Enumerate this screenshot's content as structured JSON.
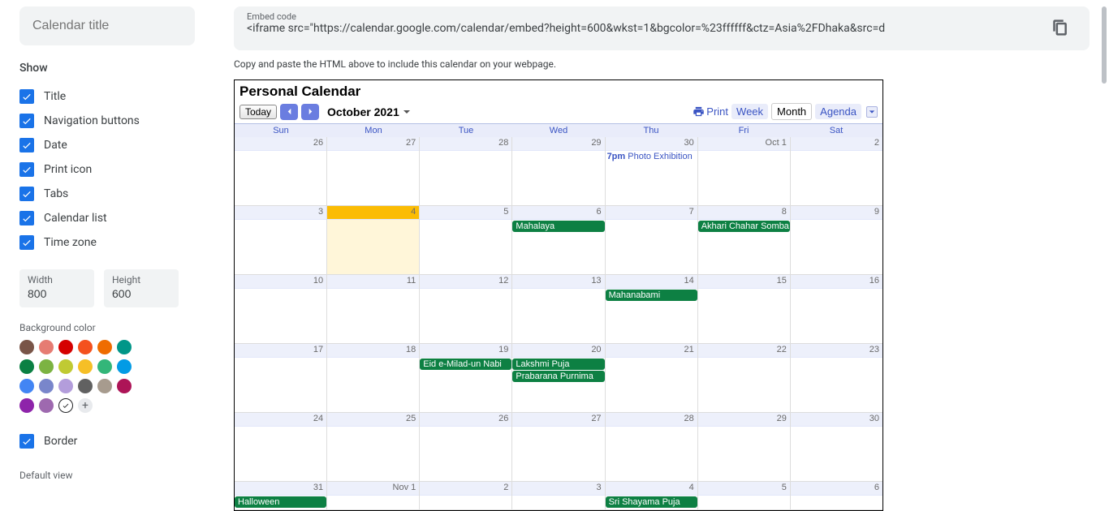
{
  "sidebar": {
    "title_placeholder": "Calendar title",
    "show_heading": "Show",
    "checks": [
      {
        "label": "Title"
      },
      {
        "label": "Navigation buttons"
      },
      {
        "label": "Date"
      },
      {
        "label": "Print icon"
      },
      {
        "label": "Tabs"
      },
      {
        "label": "Calendar list"
      },
      {
        "label": "Time zone"
      }
    ],
    "width_label": "Width",
    "width_value": "800",
    "height_label": "Height",
    "height_value": "600",
    "bg_heading": "Background color",
    "colors": [
      "#795548",
      "#e67c73",
      "#d50000",
      "#f4511e",
      "#ef6c00",
      "#009688",
      "#0b8043",
      "#7cb342",
      "#c0ca33",
      "#f6bf26",
      "#33b679",
      "#039be5",
      "#4285f4",
      "#7986cb",
      "#b39ddb",
      "#616161",
      "#a79b8e",
      "#ad1457",
      "#8e24aa",
      "#9e69af"
    ],
    "border_label": "Border",
    "default_heading": "Default view"
  },
  "main": {
    "embed_label": "Embed code",
    "embed_code": "<iframe src=\"https://calendar.google.com/calendar/embed?height=600&wkst=1&bgcolor=%23ffffff&ctz=Asia%2FDhaka&src=d",
    "hint": "Copy and paste the HTML above to include this calendar on your webpage."
  },
  "calendar": {
    "title": "Personal Calendar",
    "today": "Today",
    "month": "October 2021",
    "print": "Print",
    "views": {
      "week": "Week",
      "month": "Month",
      "agenda": "Agenda"
    },
    "dow": [
      "Sun",
      "Mon",
      "Tue",
      "Wed",
      "Thu",
      "Fri",
      "Sat"
    ],
    "weeks": [
      {
        "days": [
          {
            "num": "26"
          },
          {
            "num": "27"
          },
          {
            "num": "28"
          },
          {
            "num": "29"
          },
          {
            "num": "30",
            "timed": {
              "time": "7pm",
              "title": "Photo Exhibition"
            }
          },
          {
            "num": "Oct 1"
          },
          {
            "num": "2"
          }
        ]
      },
      {
        "days": [
          {
            "num": "3"
          },
          {
            "num": "4",
            "today": true
          },
          {
            "num": "5"
          },
          {
            "num": "6",
            "events": [
              "Mahalaya"
            ]
          },
          {
            "num": "7"
          },
          {
            "num": "8",
            "events": [
              "Akhari Chahar Somba"
            ]
          },
          {
            "num": "9"
          }
        ]
      },
      {
        "days": [
          {
            "num": "10"
          },
          {
            "num": "11"
          },
          {
            "num": "12"
          },
          {
            "num": "13"
          },
          {
            "num": "14",
            "events": [
              "Mahanabami"
            ]
          },
          {
            "num": "15"
          },
          {
            "num": "16"
          }
        ]
      },
      {
        "days": [
          {
            "num": "17"
          },
          {
            "num": "18"
          },
          {
            "num": "19",
            "events": [
              "Eid e-Milad-un Nabi"
            ]
          },
          {
            "num": "20",
            "events": [
              "Lakshmi Puja",
              "Prabarana Purnima"
            ]
          },
          {
            "num": "21"
          },
          {
            "num": "22"
          },
          {
            "num": "23"
          }
        ]
      },
      {
        "days": [
          {
            "num": "24"
          },
          {
            "num": "25"
          },
          {
            "num": "26"
          },
          {
            "num": "27"
          },
          {
            "num": "28"
          },
          {
            "num": "29"
          },
          {
            "num": "30"
          }
        ]
      },
      {
        "days": [
          {
            "num": "31",
            "events": [
              "Halloween"
            ]
          },
          {
            "num": "Nov 1"
          },
          {
            "num": "2"
          },
          {
            "num": "3"
          },
          {
            "num": "4",
            "events": [
              "Sri Shayama Puja"
            ]
          },
          {
            "num": "5"
          },
          {
            "num": "6"
          }
        ]
      }
    ]
  }
}
